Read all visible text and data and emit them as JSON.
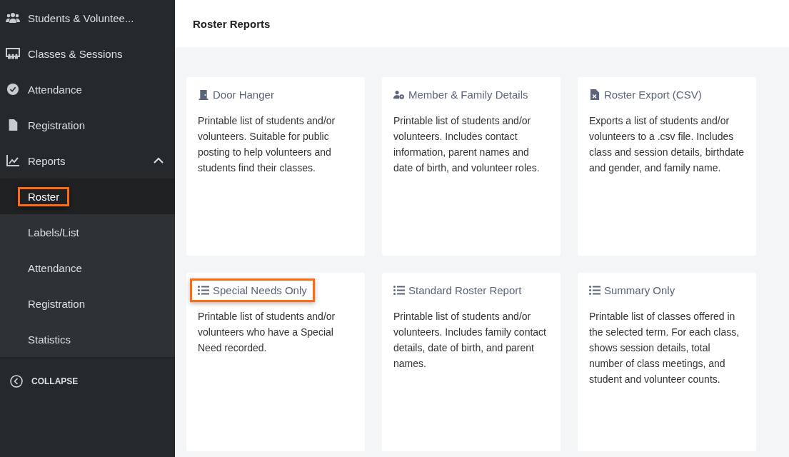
{
  "sidebar": {
    "items": [
      {
        "kind": "users",
        "label": "Students & Voluntee..."
      },
      {
        "kind": "classroom",
        "label": "Classes & Sessions"
      },
      {
        "kind": "check",
        "label": "Attendance"
      },
      {
        "kind": "file",
        "label": "Registration"
      },
      {
        "kind": "chart",
        "label": "Reports",
        "expanded": true,
        "children": [
          {
            "label": "Roster",
            "selected": true,
            "highlighted": true
          },
          {
            "label": "Labels/List",
            "selected": false,
            "highlighted": false
          },
          {
            "label": "Attendance",
            "selected": false,
            "highlighted": false
          },
          {
            "label": "Registration",
            "selected": false,
            "highlighted": false
          },
          {
            "label": "Statistics",
            "selected": false,
            "highlighted": false
          }
        ]
      }
    ],
    "collapse": "COLLAPSE"
  },
  "header": {
    "title": "Roster Reports"
  },
  "cards": [
    {
      "kind": "door",
      "title": "Door Hanger",
      "highlighted": false,
      "description": "Printable list of students and/or volunteers. Suitable for public posting to help volunteers and students find their classes."
    },
    {
      "kind": "user-cog",
      "title": "Member & Family Details",
      "highlighted": false,
      "description": "Printable list of students and/or volunteers. Includes contact information, parent names and date of birth, and volunteer roles."
    },
    {
      "kind": "file-csv",
      "title": "Roster Export (CSV)",
      "highlighted": false,
      "description": "Exports a list of students and/or volunteers to a .csv file. Includes class and session details, birthdate and gender, and family name."
    },
    {
      "kind": "list",
      "title": "Special Needs Only",
      "highlighted": true,
      "description": "Printable list of students and/or volunteers who have a Special Need recorded."
    },
    {
      "kind": "list",
      "title": "Standard Roster Report",
      "highlighted": false,
      "description": "Printable list of students and/or volunteers. Includes family contact details, date of birth, and parent names."
    },
    {
      "kind": "list",
      "title": "Summary Only",
      "highlighted": false,
      "description": "Printable list of classes offered in the selected term. For each class, shows session details, total number of class meetings, and student and volunteer counts."
    }
  ]
}
